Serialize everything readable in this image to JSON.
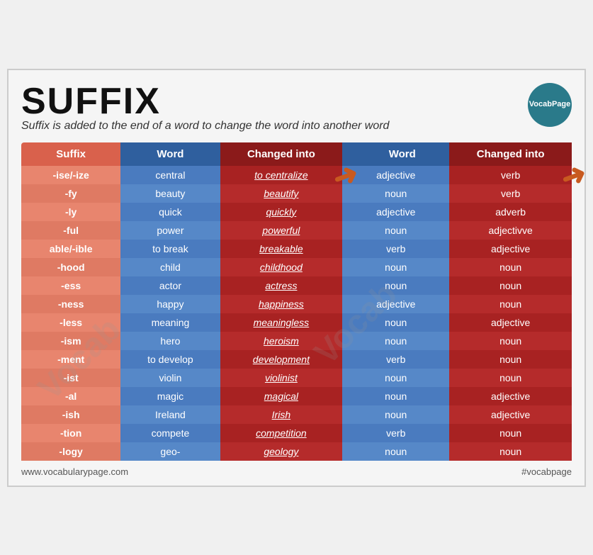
{
  "title": "SUFFIX",
  "subtitle": "Suffix is added to the end of a word to change the word into another word",
  "logo": {
    "line1": "Vocab",
    "line2": "Page"
  },
  "columns": {
    "suffix": "Suffix",
    "word1": "Word",
    "changed1": "Changed into",
    "word2": "Word",
    "changed2": "Changed into"
  },
  "rows": [
    {
      "suffix": "-ise/-ize",
      "word1": "central",
      "changed1": "to centralize",
      "word2": "adjective",
      "changed2": "verb"
    },
    {
      "suffix": "-fy",
      "word1": "beauty",
      "changed1": "beautify",
      "word2": "noun",
      "changed2": "verb"
    },
    {
      "suffix": "-ly",
      "word1": "quick",
      "changed1": "quickly",
      "word2": "adjective",
      "changed2": "adverb"
    },
    {
      "suffix": "-ful",
      "word1": "power",
      "changed1": "powerful",
      "word2": "noun",
      "changed2": "adjectivve"
    },
    {
      "suffix": "able/-ible",
      "word1": "to break",
      "changed1": "breakable",
      "word2": "verb",
      "changed2": "adjective"
    },
    {
      "suffix": "-hood",
      "word1": "child",
      "changed1": "childhood",
      "word2": "noun",
      "changed2": "noun"
    },
    {
      "suffix": "-ess",
      "word1": "actor",
      "changed1": "actress",
      "word2": "noun",
      "changed2": "noun"
    },
    {
      "suffix": "-ness",
      "word1": "happy",
      "changed1": "happiness",
      "word2": "adjective",
      "changed2": "noun"
    },
    {
      "suffix": "-less",
      "word1": "meaning",
      "changed1": "meaningless",
      "word2": "noun",
      "changed2": "adjective"
    },
    {
      "suffix": "-ism",
      "word1": "hero",
      "changed1": "heroism",
      "word2": "noun",
      "changed2": "noun"
    },
    {
      "suffix": "-ment",
      "word1": "to develop",
      "changed1": "development",
      "word2": "verb",
      "changed2": "noun"
    },
    {
      "suffix": "-ist",
      "word1": "violin",
      "changed1": "violinist",
      "word2": "noun",
      "changed2": "noun"
    },
    {
      "suffix": "-al",
      "word1": "magic",
      "changed1": "magical",
      "word2": "noun",
      "changed2": "adjective"
    },
    {
      "suffix": "-ish",
      "word1": "Ireland",
      "changed1": "Irish",
      "word2": "noun",
      "changed2": "adjective"
    },
    {
      "suffix": "-tion",
      "word1": "compete",
      "changed1": "competition",
      "word2": "verb",
      "changed2": "noun"
    },
    {
      "suffix": "-logy",
      "word1": "geo-",
      "changed1": "geology",
      "word2": "noun",
      "changed2": "noun"
    }
  ],
  "footer": {
    "left": "www.vocabularypage.com",
    "right": "#vocabpage"
  }
}
